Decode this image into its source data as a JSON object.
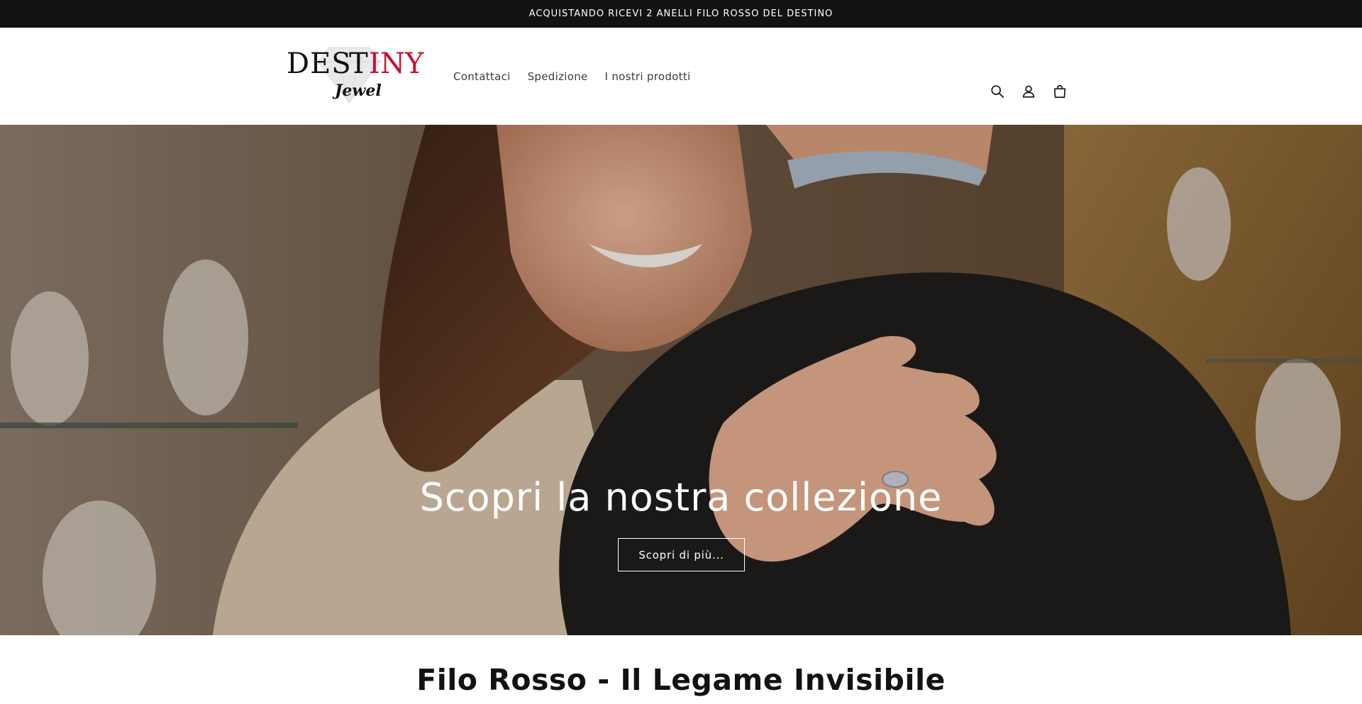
{
  "announcement": {
    "text": "ACQUISTANDO RICEVI 2 ANELLI FILO ROSSO DEL DESTINO"
  },
  "header": {
    "logo": {
      "main": "DESTINY",
      "sub": "Jewel"
    },
    "nav": [
      {
        "label": "Contattaci"
      },
      {
        "label": "Spedizione"
      },
      {
        "label": "I nostri prodotti"
      }
    ],
    "icons": [
      "search-icon",
      "account-icon",
      "cart-icon"
    ]
  },
  "hero": {
    "heading": "Scopri la nostra collezione",
    "button_label": "Scopri di più..."
  },
  "section": {
    "title": "Filo Rosso - Il Legame Invisibile"
  },
  "colors": {
    "announcement_bg": "#121212",
    "text": "#121212",
    "logo_accent": "#c8102e",
    "hero_overlay": "#000000"
  }
}
